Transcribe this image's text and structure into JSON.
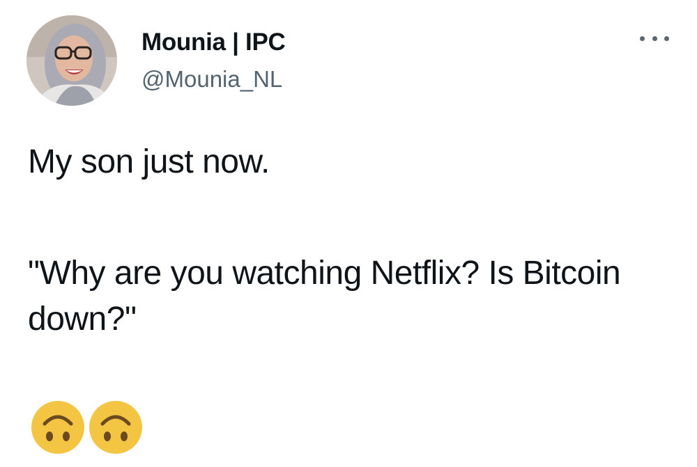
{
  "author": {
    "display_name": "Mounia | IPC",
    "handle": "@Mounia_NL",
    "avatar_icon": "user-avatar-photo"
  },
  "menu": {
    "icon": "more-options-icon"
  },
  "tweet": {
    "line1": "My son just now.",
    "line2": "\"Why are you watching Netflix? Is Bitcoin down?\"",
    "emojis": [
      "upside-down-face-emoji",
      "upside-down-face-emoji"
    ]
  },
  "colors": {
    "text": "#0f1419",
    "handle": "#536471",
    "emoji_face": "#f4c542"
  }
}
